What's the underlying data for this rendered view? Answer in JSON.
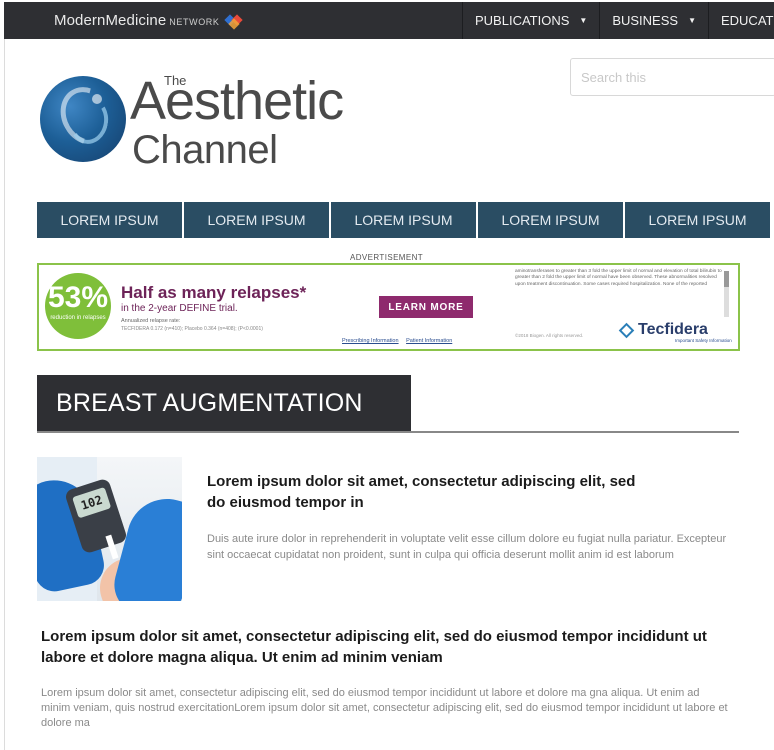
{
  "network_bar": {
    "logo_text": "ModernMedicine",
    "logo_suffix": "NETWORK",
    "nav": [
      {
        "label": "PUBLICATIONS",
        "has_dropdown": true
      },
      {
        "label": "BUSINESS",
        "has_dropdown": true
      },
      {
        "label": "EDUCATION",
        "has_dropdown": false
      }
    ],
    "colors": {
      "bar_bg": "#2e2f33"
    }
  },
  "masthead": {
    "logo_small": "The",
    "logo_line1": "Aesthetic",
    "logo_line2": "Channel",
    "search_placeholder": "Search this"
  },
  "main_nav": {
    "items": [
      "LOREM IPSUM",
      "LOREM IPSUM",
      "LOREM IPSUM",
      "LOREM IPSUM",
      "LOREM IPSUM"
    ],
    "color": "#2a4d63"
  },
  "advertisement": {
    "label": "ADVERTISEMENT",
    "percent": "53%",
    "percent_caption": "reduction in relapses",
    "headline": "Half as many relapses*",
    "subhead": "in the 2-year DEFINE trial.",
    "fine_print_1": "Annualized relapse rate:",
    "fine_print_2": "TECFIDERA 0.172 (n=410); Placebo 0.364 (n=408); (P<0.0001)",
    "cta": "LEARN MORE",
    "link_1": "Prescribing Information",
    "link_2": "Patient Information",
    "side_text": "aminotransferases to greater than 3 fold the upper limit of normal and elevation of total bilirubin to greater than 2 fold the upper limit of normal have been observed. These abnormalities resolved upon treatment discontinuation. Some cases required hospitalization. None of the reported",
    "brand": "Tecfidera",
    "bottom_note": "©2018 Biogen. All rights reserved.",
    "corner_link": "Important Safety Information",
    "border_color": "#8bc34a",
    "cta_color": "#8e2a6d"
  },
  "section": {
    "title": "BREAST AUGMENTATION"
  },
  "featured": {
    "meter_reading": "102",
    "title": "Lorem ipsum dolor sit amet, consectetur adipiscing elit, sed do eiusmod tempor in",
    "excerpt": "Duis aute irure dolor in reprehenderit in voluptate velit esse cillum dolore eu fugiat nulla pariatur. Excepteur sint occaecat cupidatat non proident, sunt in culpa qui officia deserunt mollit anim id est laborum"
  },
  "article2": {
    "title": "Lorem ipsum dolor sit amet, consectetur adipiscing elit, sed do eiusmod tempor incididunt ut labore et dolore magna aliqua. Ut enim ad minim veniam",
    "excerpt": "Lorem ipsum dolor sit amet, consectetur adipiscing elit, sed do eiusmod tempor incididunt ut labore et dolore ma gna aliqua. Ut enim ad minim veniam, quis nostrud exercitationLorem ipsum dolor sit amet, consectetur adipiscing elit, sed do eiusmod tempor incididunt ut labore et dolore ma"
  }
}
